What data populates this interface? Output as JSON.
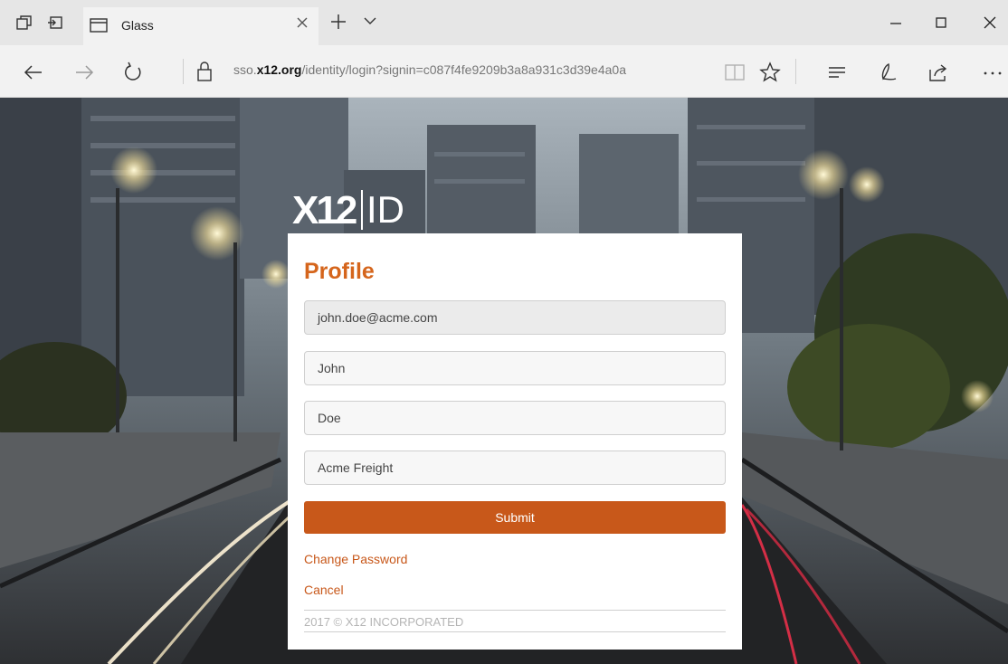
{
  "browser": {
    "tab_title": "Glass",
    "url_prefix": "sso.",
    "url_domain": "x12.org",
    "url_path": "/identity/login?signin=c087f4fe9209b3a8a931c3d39e4a0a"
  },
  "brand": {
    "logo_main": "X12",
    "logo_suffix": "ID"
  },
  "form": {
    "title": "Profile",
    "email": "john.doe@acme.com",
    "first_name": "John",
    "last_name": "Doe",
    "company": "Acme Freight",
    "submit_label": "Submit",
    "change_password_label": "Change Password",
    "cancel_label": "Cancel",
    "copyright": "2017 © X12 INCORPORATED"
  },
  "colors": {
    "accent": "#d5651c",
    "button": "#c8581a"
  },
  "icons": [
    "tab-preview-icon",
    "tab-aside-icon",
    "page-icon",
    "close-icon",
    "plus-icon",
    "chevron-down-icon",
    "minimize-icon",
    "maximize-icon",
    "window-close-icon",
    "back-icon",
    "forward-icon",
    "refresh-icon",
    "lock-icon",
    "reading-view-icon",
    "star-icon",
    "hub-icon",
    "pen-icon",
    "share-icon",
    "more-icon"
  ]
}
